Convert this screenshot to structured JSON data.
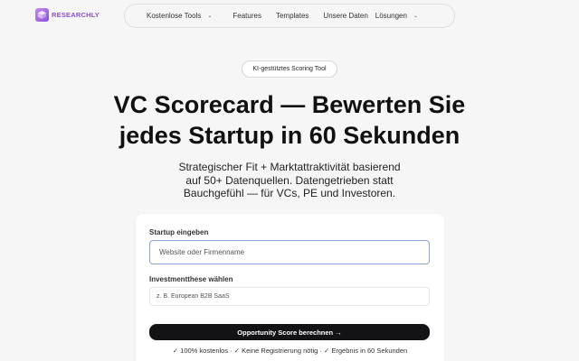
{
  "brand": {
    "name": "RESEARCHLY",
    "logo_icon": "cube-icon",
    "accent": "#8b52d8"
  },
  "nav": {
    "items": [
      {
        "label": "Kostenlose Tools",
        "has_dropdown": true
      },
      {
        "label": "Features",
        "has_dropdown": false
      },
      {
        "label": "Templates",
        "has_dropdown": false
      },
      {
        "label": "Unsere Daten",
        "has_dropdown": false
      },
      {
        "label": "Lösungen",
        "has_dropdown": true
      }
    ],
    "dropdown_icon": "chevron-down-icon"
  },
  "hero": {
    "badge": "KI-gestütztes Scoring Tool",
    "title_line1": "VC Scorecard — Bewerten Sie",
    "title_line2": "jedes Startup in 60 Sekunden",
    "subtitle_line1": "Strategischer Fit + Marktattraktivität basierend",
    "subtitle_line2": "auf 50+ Datenquellen. Datengetrieben statt",
    "subtitle_line3": "Bauchgefühl — für VCs, PE und Investoren."
  },
  "form": {
    "startup_label": "Startup eingeben",
    "startup_placeholder": "Website oder Firmenname",
    "thesis_label": "Investmentthese wählen",
    "thesis_placeholder": "z. B. European B2B SaaS",
    "submit_label": "Opportunity Score berechnen →",
    "perks": "✓ 100% kostenlos · ✓ Keine Registrierung nötig · ✓ Ergebnis in 60 Sekunden"
  },
  "colors": {
    "background": "#f6f6f7",
    "button": "#131316",
    "input_focus_border": "#8aa4d6"
  }
}
